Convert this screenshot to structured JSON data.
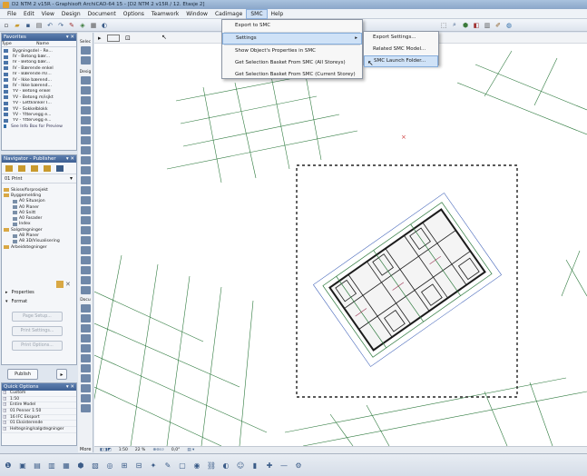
{
  "window": {
    "title": "D2 NTM 2 v15R - Graphisoft ArchiCAD-64 15 - [D2 NTM 2 v15R / 12. Etasje 2]"
  },
  "menubar": {
    "items": [
      "File",
      "Edit",
      "View",
      "Design",
      "Document",
      "Options",
      "Teamwork",
      "Window",
      "Cadimage",
      "SMC",
      "Help"
    ],
    "active": "SMC"
  },
  "smc_menu": {
    "items": [
      {
        "label": "Export to SMC"
      },
      {
        "label": "Settings"
      },
      {
        "label": "Show Object's Properties in SMC"
      },
      {
        "label": "Get Selection Basket From SMC (All Storeys)"
      },
      {
        "label": "Get Selection Basket From SMC (Current Storey)"
      }
    ],
    "highlighted": "Settings"
  },
  "settings_submenu": {
    "items": [
      {
        "label": "Export Settings..."
      },
      {
        "label": "Related SMC Model..."
      },
      {
        "label": "SMC Launch Folder..."
      }
    ],
    "highlighted": "SMC Launch Folder..."
  },
  "favorites": {
    "header": "Favorites",
    "col_type": "Type",
    "col_name": "Name",
    "items": [
      "Bygningsdel - Re...",
      "IV - Betong bær...",
      "IV - Betong bær...",
      "IV - Bærende enkel",
      "IV - Bærende m/...",
      "IV - Ikke bærend...",
      "IV - Ikke bærend...",
      "YV - Betong enkel",
      "YV - Betong m/isjkt",
      "YV - Lettklinker I...",
      "YV - Sokkelblokk",
      "YV - Yttervegg e...",
      "YV - Yttervegg e..."
    ],
    "footer": "See Info Box for Preview"
  },
  "navigator": {
    "header": "Navigator - Publisher",
    "set_name": "01 Print",
    "tree": [
      "Skisse/forprosjekt",
      "Byggemelding",
      "A0 Situasjon",
      "A0 Planer",
      "A0 Snitt",
      "A0 Fasader",
      "Index",
      "Salgstegninger",
      "A8 Planer",
      "A8 3D/Visualisering",
      "Arbeidstegninger"
    ]
  },
  "publisher": {
    "properties_label": "Properties",
    "format_label": "Format",
    "page_setup": "Page Setup...",
    "print_settings": "Print Settings...",
    "print_options": "Print Options...",
    "publish_button": "Publish"
  },
  "quick_options": {
    "header": "Quick Options",
    "rows": [
      "Custom",
      "1:50",
      "Entire Model",
      "01 Penner 1:50",
      "16 IFC Eksport",
      "01 Eksisterende",
      "Heltegning/salgstegninger"
    ]
  },
  "toolbox": {
    "design_label": "Desig",
    "docu_label": "Docu",
    "select_label": "Selec",
    "more_label": "More"
  },
  "status": {
    "scale": "1:50",
    "zoom": "22 %",
    "angle": "0,0°"
  },
  "colors": {
    "menu_highlight": "#cfe2f7",
    "panel_header": "#3d5f92",
    "grid_line": "#2e7a3e",
    "plan_line": "#1b1b1b",
    "dashed_frame": "#222222"
  }
}
